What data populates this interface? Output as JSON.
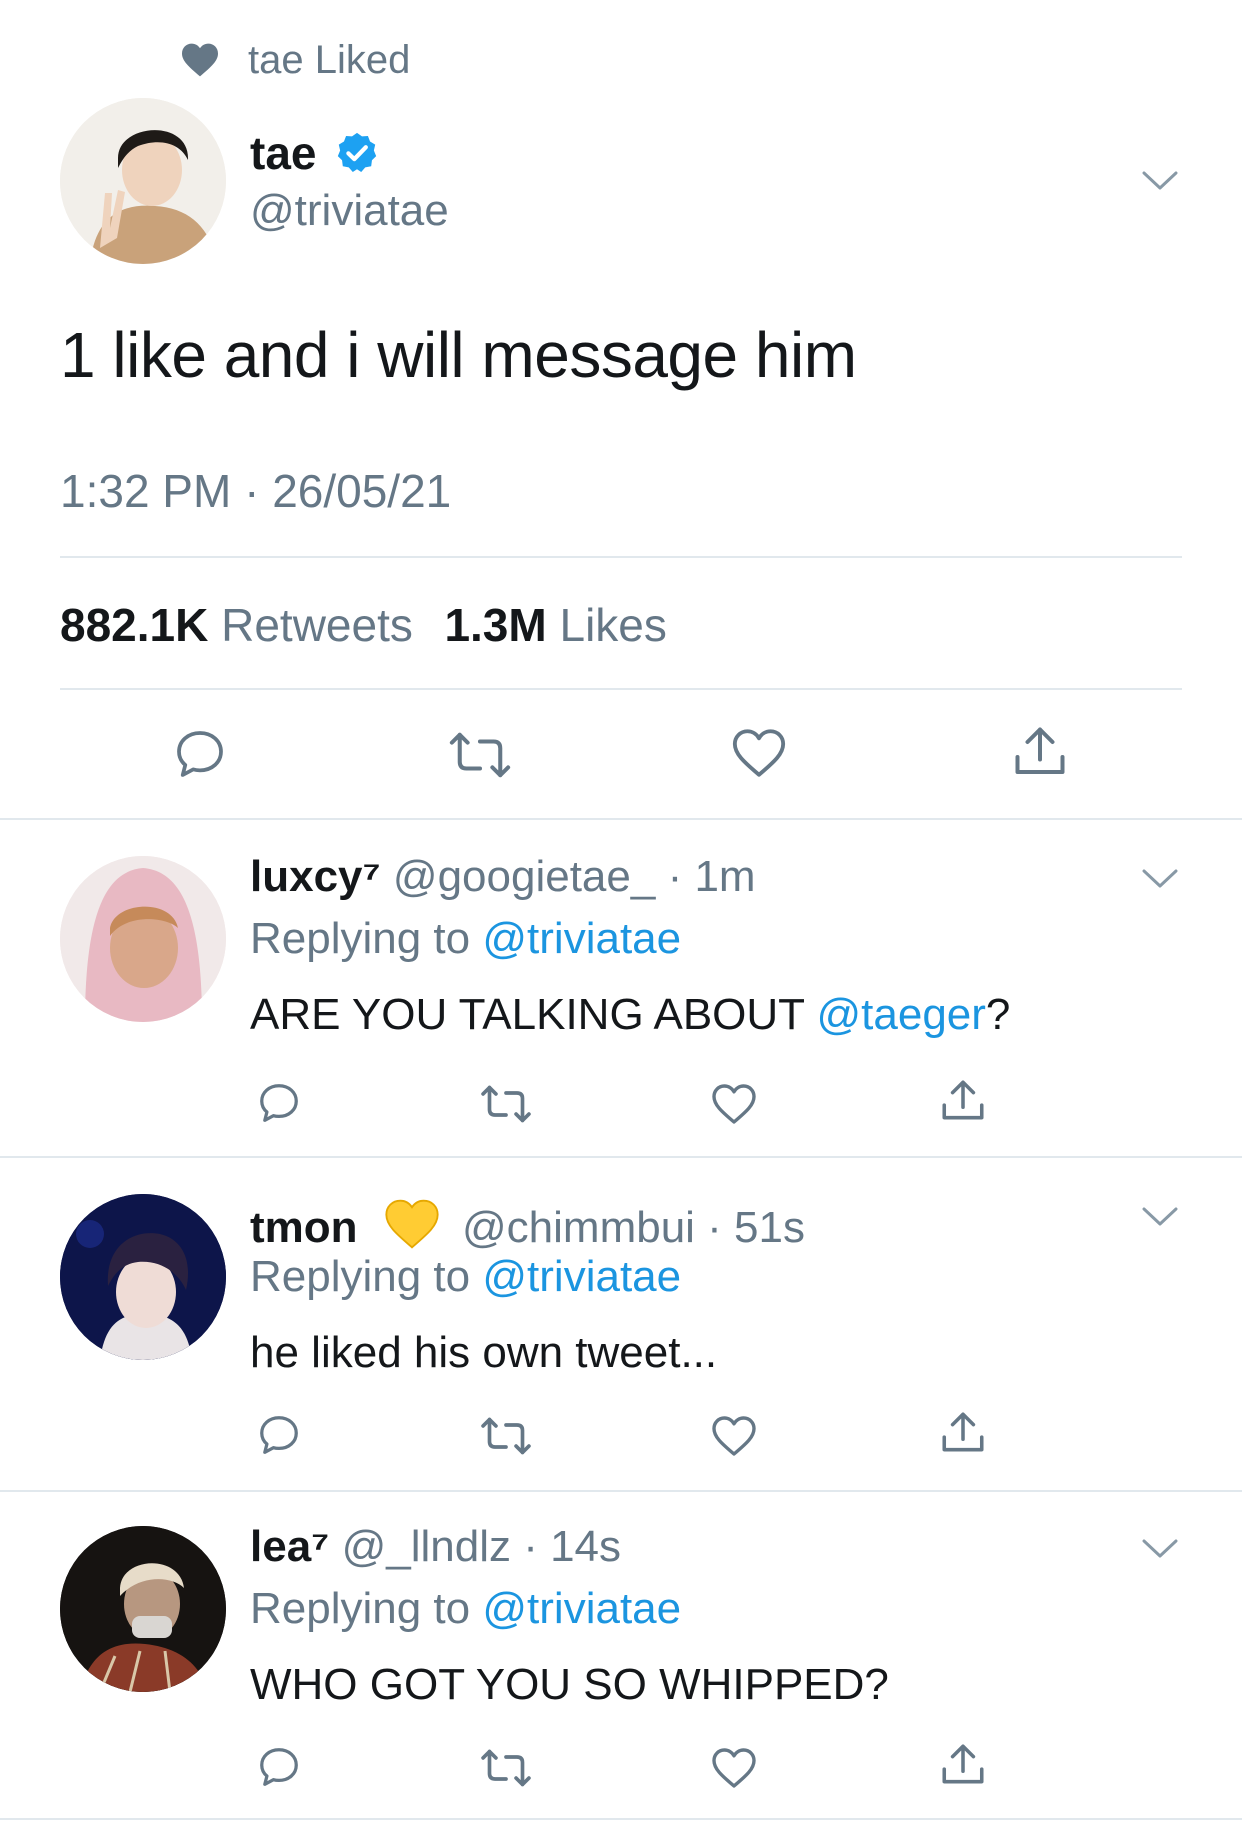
{
  "colors": {
    "accent": "#1b95e0",
    "grey": "#657786",
    "text": "#14171a",
    "divider": "#e1e8ed",
    "verified": "#1da1f2"
  },
  "context": {
    "icon": "heart-filled-icon",
    "text": "tae Liked"
  },
  "tweet": {
    "name": "tae",
    "verified": true,
    "handle": "@triviatae",
    "body": "1 like and i will message him",
    "timestamp": "1:32 PM · 26/05/21",
    "retweets_count": "882.1K",
    "retweets_label": "Retweets",
    "likes_count": "1.3M",
    "likes_label": "Likes",
    "actions": [
      "reply-icon",
      "retweet-icon",
      "like-icon",
      "share-icon"
    ]
  },
  "replies": [
    {
      "name": "luxcy⁷",
      "handle": "@googietae_",
      "time": "· 1m",
      "replying_prefix": "Replying to",
      "replying_to": "@triviatae",
      "text_before": "ARE YOU TALKING ABOUT ",
      "mention": "@taeger",
      "text_after": "?"
    },
    {
      "name": "tmon",
      "emoji": "💛",
      "handle": "@chimmbui",
      "time": "· 51s",
      "replying_prefix": "Replying to",
      "replying_to": "@triviatae",
      "text": "he liked his own tweet..."
    },
    {
      "name": "lea⁷",
      "handle": "@_llndlz",
      "time": "· 14s",
      "replying_prefix": "Replying to",
      "replying_to": "@triviatae",
      "text": "WHO GOT YOU SO WHIPPED?"
    }
  ]
}
